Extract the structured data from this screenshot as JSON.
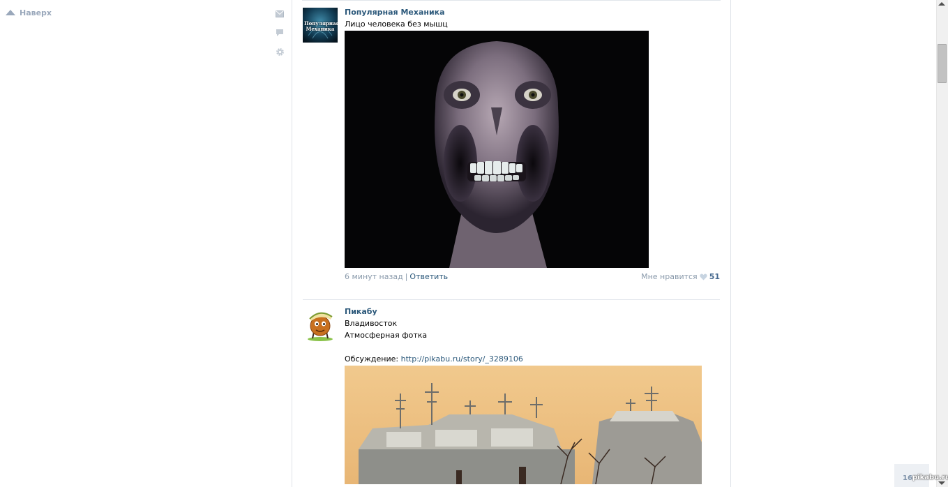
{
  "left_menu": {
    "to_top_label": "Наверх"
  },
  "quick_icons": [
    "envelope-icon",
    "speech-bubble-icon",
    "gear-icon"
  ],
  "posts": [
    {
      "author": "Популярная Механика",
      "avatar_text": "Популярная Механика",
      "text_lines": [
        "Лицо человека без мышц"
      ],
      "time": "6 минут назад",
      "reply_label": "Ответить",
      "like_label": "Мне нравится",
      "like_count": "51"
    },
    {
      "author": "Пикабу",
      "text_lines": [
        "Владивосток",
        "Атмосферная фотка"
      ],
      "discussion_label": "Обсуждение:",
      "discussion_link": "http://pikabu.ru/story/_3289106"
    }
  ],
  "counter_badge": "16",
  "watermark": "pikabu.ru",
  "colors": {
    "link": "#2b587a",
    "muted": "#8a9aab",
    "divider": "#e1e5eb"
  }
}
